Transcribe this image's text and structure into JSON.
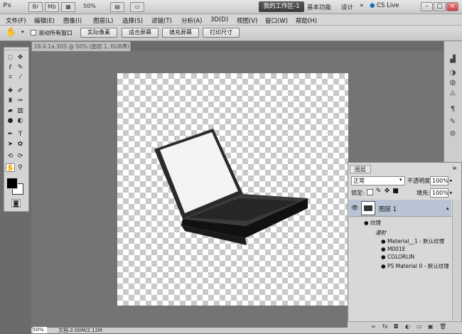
{
  "app": {
    "logo": "Ps",
    "zoom": "50%"
  },
  "workspaces": {
    "active": "我的工作区-1",
    "basic": "基本功能",
    "design": "设计",
    "more": "»",
    "cslive": "CS Live"
  },
  "window_controls": [
    "–",
    "□",
    "×"
  ],
  "menu": [
    "文件(F)",
    "编辑(E)",
    "图像(I)",
    "图层(L)",
    "选择(S)",
    "滤镜(T)",
    "分析(A)",
    "3D(D)",
    "视图(V)",
    "窗口(W)",
    "帮助(H)"
  ],
  "options": {
    "scroll_all": "滚动所有窗口",
    "buttons": [
      "实际像素",
      "适合屏幕",
      "填充屏幕",
      "打印尺寸"
    ]
  },
  "document": {
    "tab": "18.4.1a.3DS @ 50% (图层 1, RGB/8)",
    "close": "×"
  },
  "status": {
    "zoom": "50%",
    "doc": "文档:2.00M/2.12M"
  },
  "layers": {
    "tab": "图层",
    "blend_mode": "正常",
    "opacity_label": "不透明度:",
    "opacity": "100%",
    "lock_label": "锁定:",
    "fill_label": "填充:",
    "fill": "100%",
    "layer_name": "图层 1",
    "textures": "纹理",
    "diffuse": "漫射",
    "items": [
      "Material__1 - 默认纹理",
      "M001E",
      "COLORLIN",
      "PS Material 0 - 默认纹理"
    ]
  }
}
